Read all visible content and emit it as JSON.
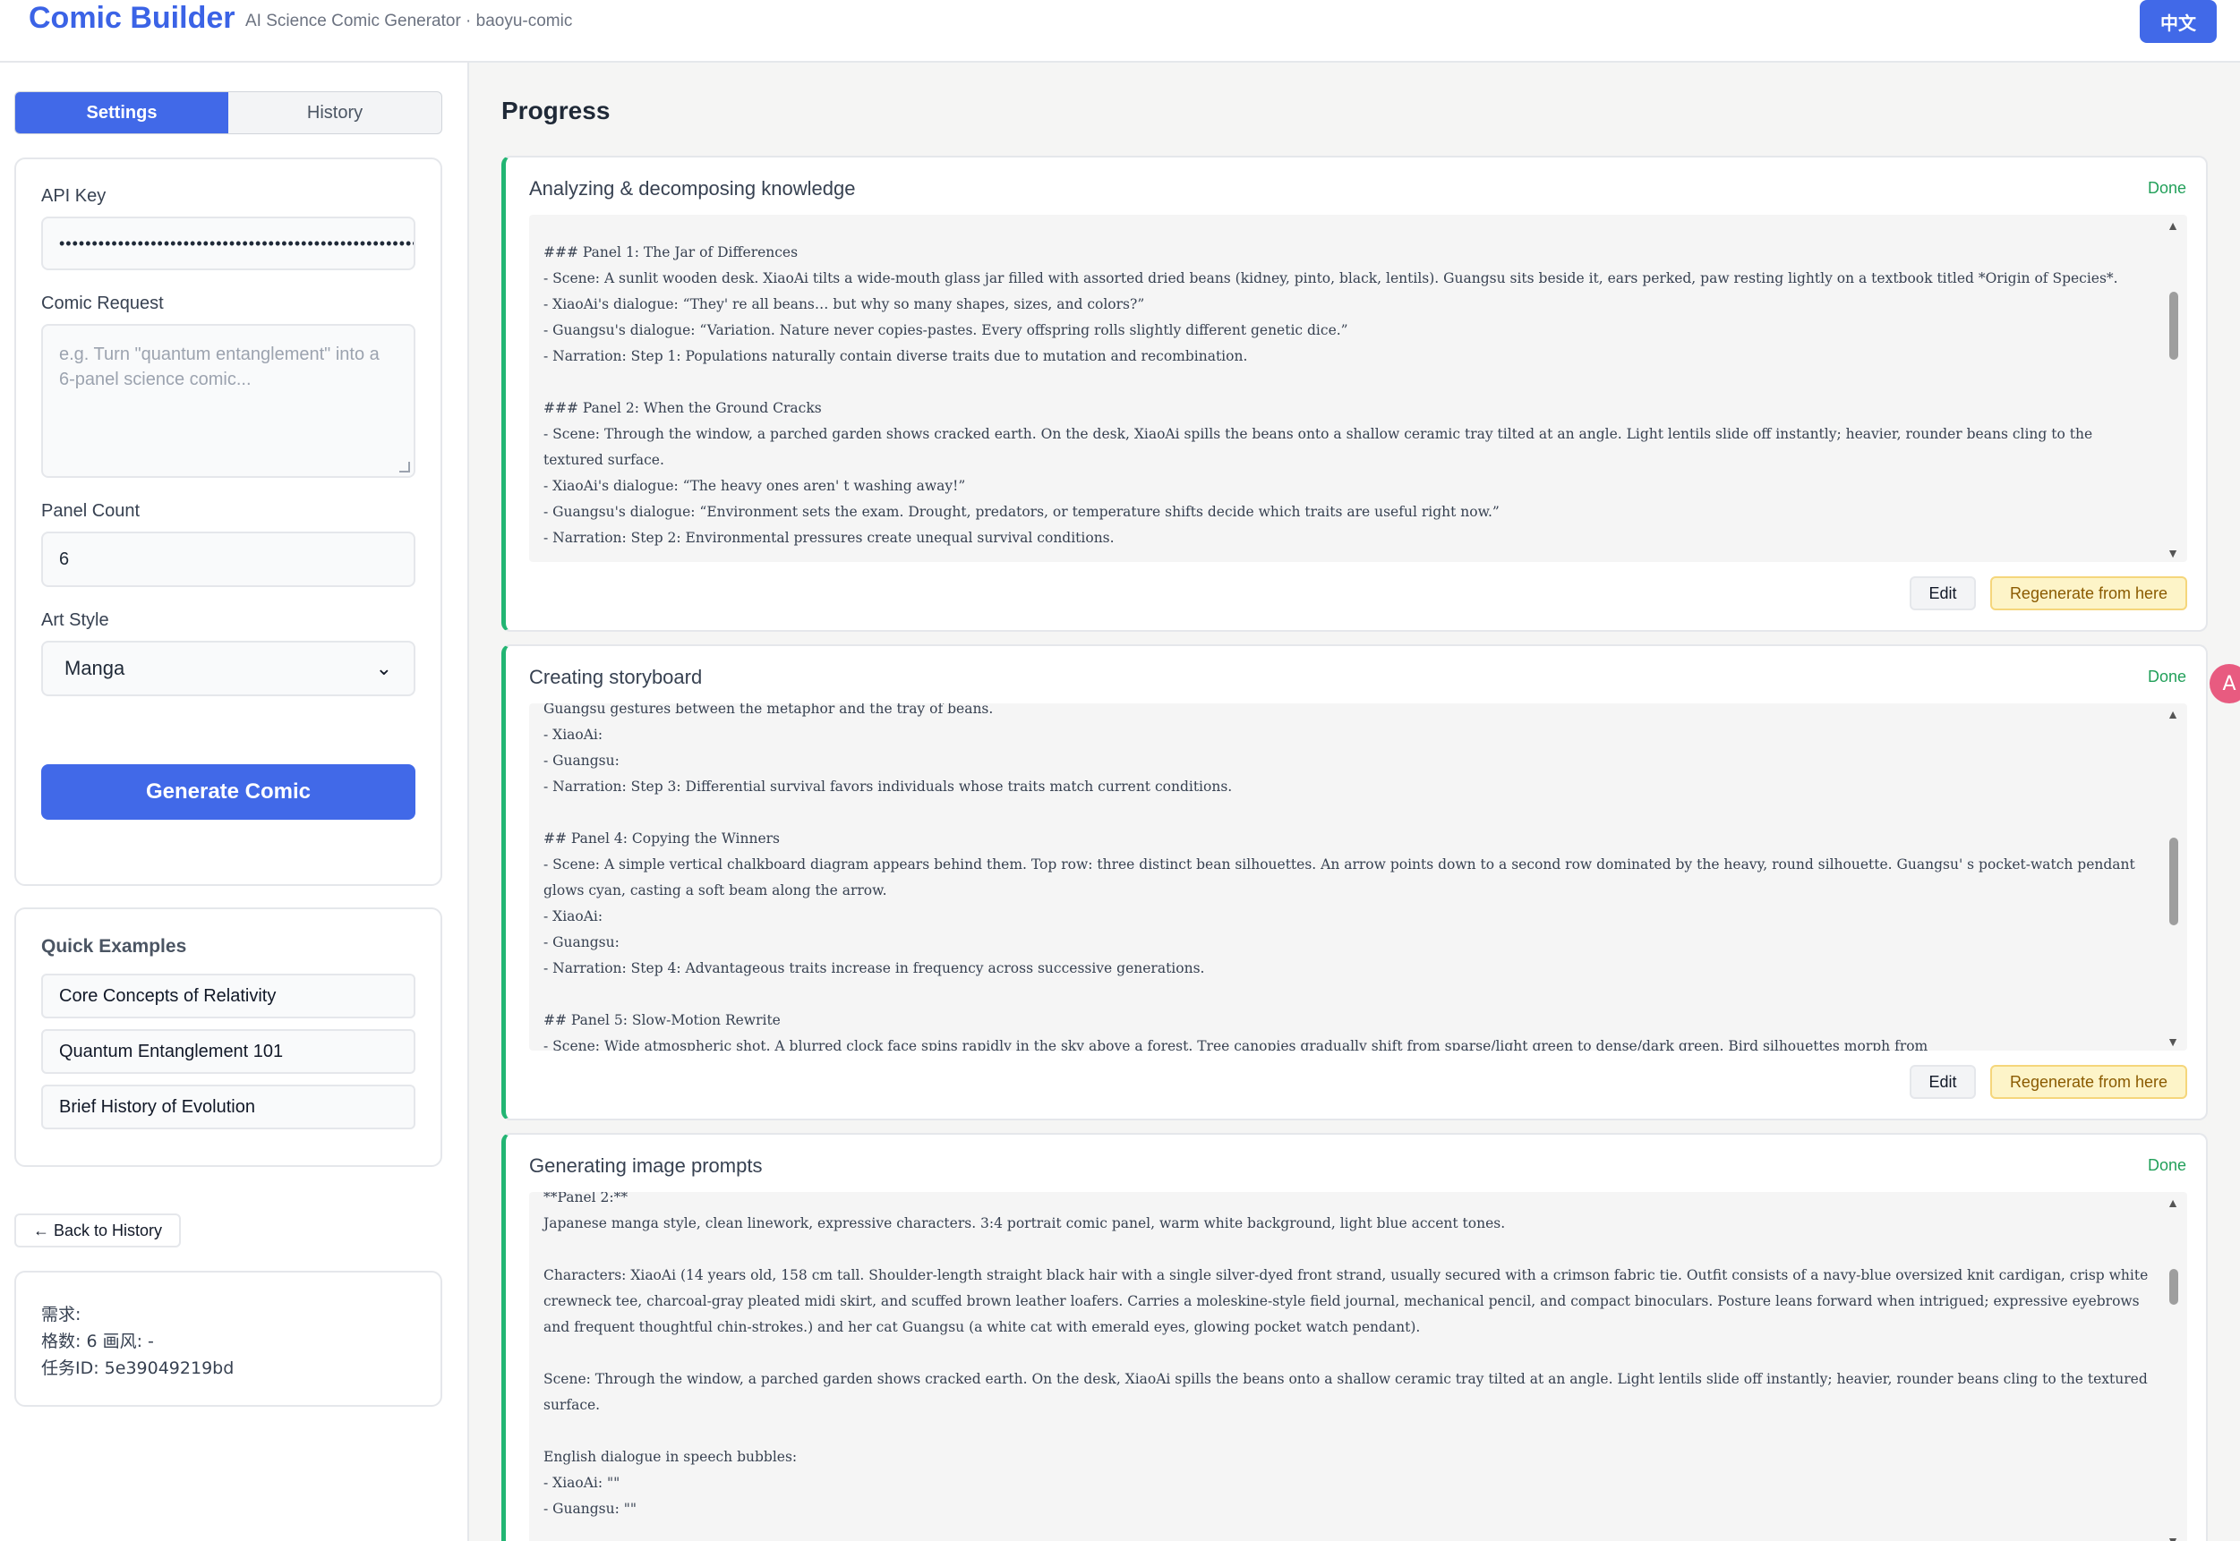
{
  "header": {
    "brand": "Comic Builder",
    "tagline": "AI Science Comic Generator · baoyu-comic",
    "lang_button": "中文"
  },
  "sidebar": {
    "tabs": [
      {
        "label": "Settings",
        "active": true
      },
      {
        "label": "History",
        "active": false
      }
    ],
    "settings": {
      "api_key_label": "API Key",
      "api_key_value": "••••••••••••••••••••••••••••••••••••••••••••••••••••••••",
      "request_label": "Comic Request",
      "request_placeholder": "e.g. Turn \"quantum entanglement\" into a 6-panel science comic...",
      "panel_count_label": "Panel Count",
      "panel_count_value": "6",
      "art_style_label": "Art Style",
      "art_style_value": "Manga",
      "generate_button": "Generate Comic"
    },
    "examples": {
      "title": "Quick Examples",
      "items": [
        "Core Concepts of Relativity",
        "Quantum Entanglement 101",
        "Brief History of Evolution"
      ]
    },
    "back_button": "← Back to History",
    "task": {
      "request_line": "需求:",
      "panels_line": "格数: 6   画风: -",
      "task_id_line": "任务ID: 5e39049219bd"
    }
  },
  "main": {
    "title": "Progress",
    "edit_label": "Edit",
    "regen_label": "Regenerate from here",
    "stages": [
      {
        "title": "Analyzing & decomposing knowledge",
        "status": "Done",
        "log": "### Panel 1: The Jar of Differences\n- Scene: A sunlit wooden desk. XiaoAi tilts a wide-mouth glass jar filled with assorted dried beans (kidney, pinto, black, lentils). Guangsu sits beside it, ears perked, paw resting lightly on a textbook titled *Origin of Species*.\n- XiaoAi's dialogue: “They' re all beans… but why so many shapes, sizes, and colors?”\n- Guangsu's dialogue: “Variation. Nature never copies-pastes. Every offspring rolls slightly different genetic dice.”\n- Narration: Step 1: Populations naturally contain diverse traits due to mutation and recombination.\n\n### Panel 2: When the Ground Cracks\n- Scene: Through the window, a parched garden shows cracked earth. On the desk, XiaoAi spills the beans onto a shallow ceramic tray tilted at an angle. Light lentils slide off instantly; heavier, rounder beans cling to the textured surface.\n- XiaoAi's dialogue: “The heavy ones aren' t washing away!”\n- Guangsu's dialogue: “Environment sets the exam. Drought, predators, or temperature shifts decide which traits are useful right now.”\n- Narration: Step 2: Environmental pressures create unequal survival conditions."
      },
      {
        "title": "Creating storyboard",
        "status": "Done",
        "log": "Guangsu gestures between the metaphor and the tray of beans.\n- XiaoAi:\n- Guangsu:\n- Narration: Step 3: Differential survival favors individuals whose traits match current conditions.\n\n## Panel 4: Copying the Winners\n- Scene: A simple vertical chalkboard diagram appears behind them. Top row: three distinct bean silhouettes. An arrow points down to a second row dominated by the heavy, round silhouette. Guangsu' s pocket-watch pendant glows cyan, casting a soft beam along the arrow.\n- XiaoAi:\n- Guangsu:\n- Narration: Step 4: Advantageous traits increase in frequency across successive generations.\n\n## Panel 5: Slow-Motion Rewrite\n- Scene: Wide atmospheric shot. A blurred clock face spins rapidly in the sky above a forest. Tree canopies gradually shift from sparse/light green to dense/dark green. Bird silhouettes morph from"
      },
      {
        "title": "Generating image prompts",
        "status": "Done",
        "log": "**Panel 2:**\nJapanese manga style, clean linework, expressive characters. 3:4 portrait comic panel, warm white background, light blue accent tones.\n\nCharacters: XiaoAi (14 years old, 158 cm tall. Shoulder-length straight black hair with a single silver-dyed front strand, usually secured with a crimson fabric tie. Outfit consists of a navy-blue oversized knit cardigan, crisp white crewneck tee, charcoal-gray pleated midi skirt, and scuffed brown leather loafers. Carries a moleskine-style field journal, mechanical pencil, and compact binoculars. Posture leans forward when intrigued; expressive eyebrows and frequent thoughtful chin-strokes.) and her cat Guangsu (a white cat with emerald eyes, glowing pocket watch pendant).\n\nScene: Through the window, a parched garden shows cracked earth. On the desk, XiaoAi spills the beans onto a shallow ceramic tray tilted at an angle. Light lentils slide off instantly; heavier, rounder beans cling to the textured surface.\n\nEnglish dialogue in speech bubbles:\n- XiaoAi: \"\"\n- Guangsu: \"\""
      }
    ]
  },
  "floating_badge": "A"
}
